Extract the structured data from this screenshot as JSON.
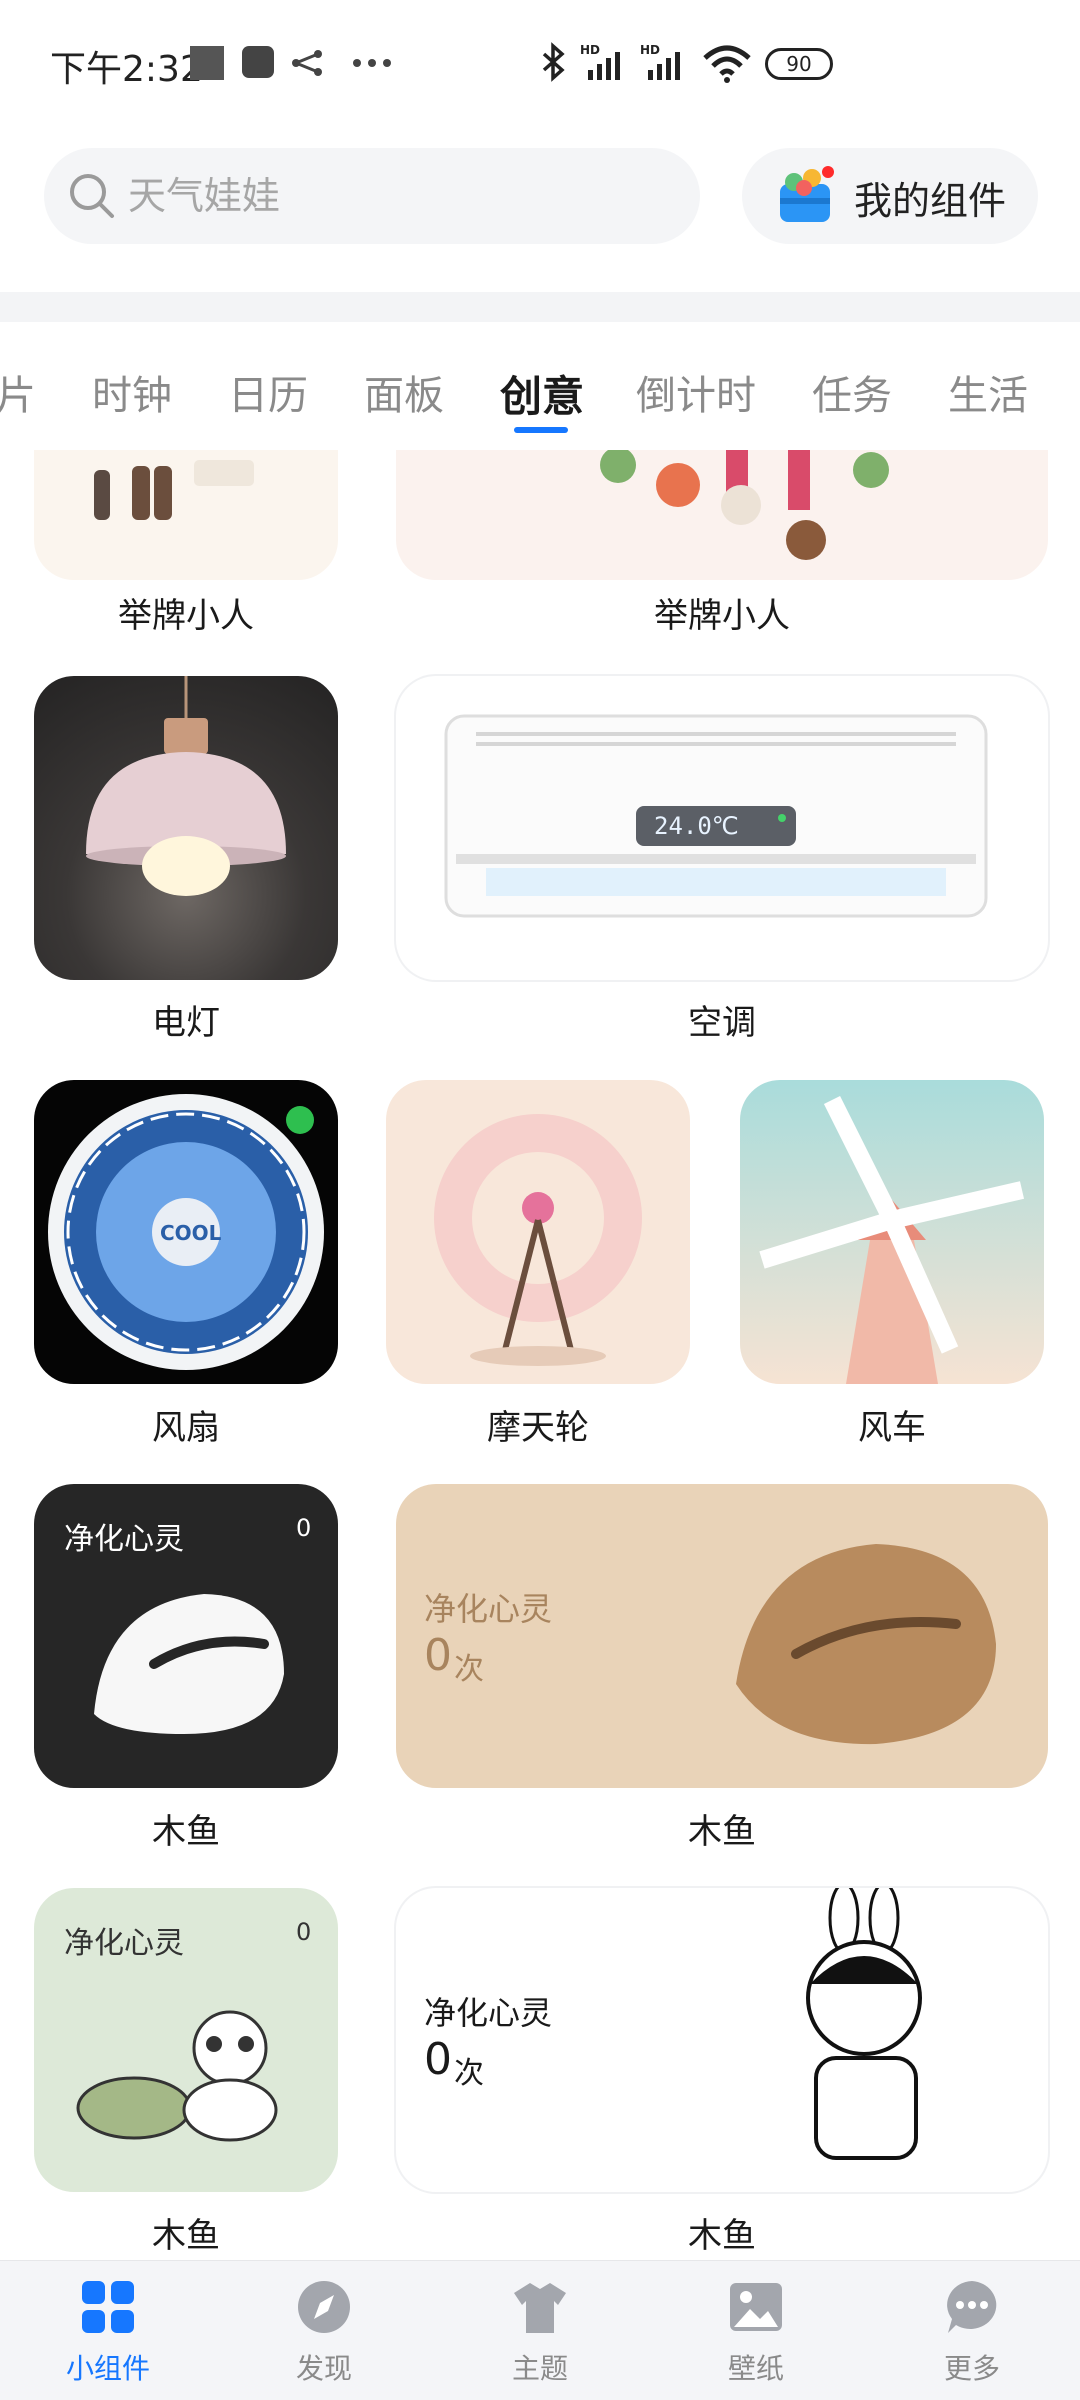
{
  "status_bar": {
    "time": "下午2:32",
    "battery": "90"
  },
  "search": {
    "placeholder": "天气娃娃"
  },
  "my_widgets": {
    "label": "我的组件"
  },
  "tabs": [
    "片",
    "时钟",
    "日历",
    "面板",
    "创意",
    "倒计时",
    "任务",
    "生活"
  ],
  "active_tab": "创意",
  "cards": {
    "sign_person_1": {
      "label": "举牌小人"
    },
    "sign_person_2": {
      "label": "举牌小人"
    },
    "lamp": {
      "label": "电灯"
    },
    "aircon": {
      "label": "空调",
      "display": "24.0℃"
    },
    "fan": {
      "label": "风扇",
      "hub_text": "COOL"
    },
    "ferris": {
      "label": "摩天轮"
    },
    "windmill": {
      "label": "风车"
    },
    "fish_dark": {
      "label": "木鱼",
      "title": "净化心灵",
      "count": "0"
    },
    "fish_wood": {
      "label": "木鱼",
      "title": "净化心灵",
      "count": "0",
      "unit": "次"
    },
    "fish_panda": {
      "label": "木鱼",
      "title": "净化心灵",
      "count": "0"
    },
    "fish_cartoon": {
      "label": "木鱼",
      "title": "净化心灵",
      "count": "0",
      "unit": "次"
    }
  },
  "bottom_nav": [
    {
      "label": "小组件",
      "icon": "widgets-icon",
      "active": true
    },
    {
      "label": "发现",
      "icon": "compass-icon",
      "active": false
    },
    {
      "label": "主题",
      "icon": "tshirt-icon",
      "active": false
    },
    {
      "label": "壁纸",
      "icon": "picture-icon",
      "active": false
    },
    {
      "label": "更多",
      "icon": "more-chat-icon",
      "active": false
    }
  ],
  "colors": {
    "accent": "#1677ff",
    "wood_card_bg": "#e9d3b8",
    "panda_card_bg": "#dde9d8",
    "dark_card_bg": "#262626"
  }
}
